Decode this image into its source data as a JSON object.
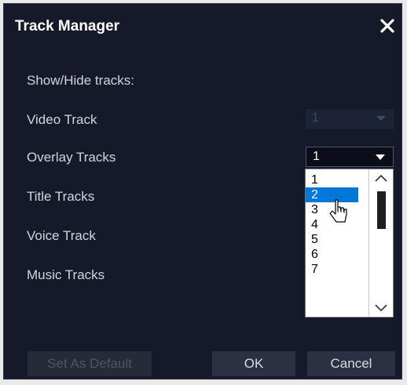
{
  "dialog": {
    "title": "Track Manager",
    "section_label": "Show/Hide tracks:"
  },
  "tracks": [
    {
      "label": "Video Track"
    },
    {
      "label": "Overlay Tracks"
    },
    {
      "label": "Title Tracks"
    },
    {
      "label": "Voice Track"
    },
    {
      "label": "Music Tracks"
    }
  ],
  "video_track_select": {
    "value": "1",
    "disabled": true
  },
  "overlay_tracks_select": {
    "value": "1",
    "expanded": true
  },
  "dropdown": {
    "options": [
      "1",
      "2",
      "3",
      "4",
      "5",
      "6",
      "7"
    ],
    "highlighted": "2"
  },
  "buttons": {
    "set_default": "Set As Default",
    "ok": "OK",
    "cancel": "Cancel"
  },
  "colors": {
    "dialog_background": "#15192a",
    "highlight": "#0078d7",
    "button_background": "#2b3142"
  }
}
